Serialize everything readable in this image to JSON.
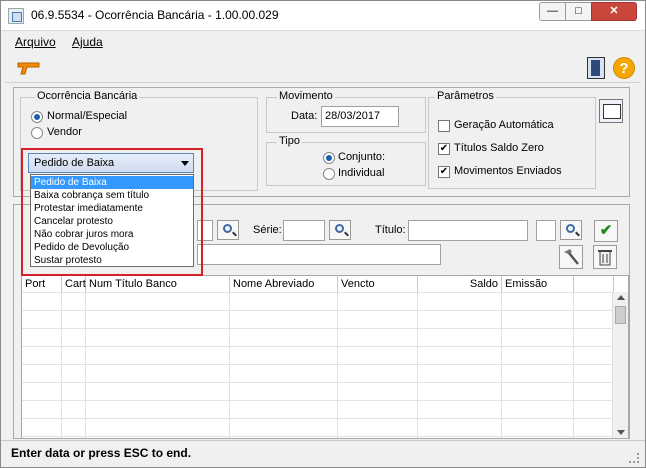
{
  "window": {
    "title": "06.9.5534 - Ocorrência Bancária - 1.00.00.029",
    "min_glyph": "—",
    "max_glyph": "□",
    "close_glyph": "✕"
  },
  "menu": {
    "arquivo": "Arquivo",
    "ajuda": "Ajuda"
  },
  "toolbar": {
    "help_glyph": "?"
  },
  "ocorrencia": {
    "legend": "Ocorrência Bancária",
    "radios": [
      {
        "label": "Normal/Especial",
        "selected": true
      },
      {
        "label": "Vendor",
        "selected": false
      }
    ],
    "combo": {
      "value": "Pedido de Baixa",
      "options": [
        "Pedido de Baixa",
        "Baixa cobrança sem título",
        "Protestar imediatamente",
        "Cancelar protesto",
        "Não cobrar juros mora",
        "Pedido de Devolução",
        "Sustar protesto"
      ]
    }
  },
  "movimento": {
    "legend": "Movimento",
    "data_label": "Data:",
    "data_value": "28/03/2017"
  },
  "tipo": {
    "legend": "Tipo",
    "radios": [
      {
        "label": "Conjunto:",
        "selected": true
      },
      {
        "label": "Individual",
        "selected": false
      }
    ]
  },
  "parametros": {
    "legend": "Parâmetros",
    "checks": [
      {
        "label": "Geração Automática",
        "checked": false
      },
      {
        "label": "Títulos Saldo Zero",
        "checked": true
      },
      {
        "label": "Movimentos Enviados",
        "checked": true
      }
    ]
  },
  "filters": {
    "serie_label": "Série:",
    "titulo_label": "Título:",
    "ok_glyph": "✔"
  },
  "grid": {
    "columns": [
      "Port",
      "Cart",
      "Num Título Banco",
      "Nome Abreviado",
      "Vencto",
      "Saldo",
      "Emissão"
    ]
  },
  "status": {
    "text": "Enter data or press ESC to end."
  }
}
